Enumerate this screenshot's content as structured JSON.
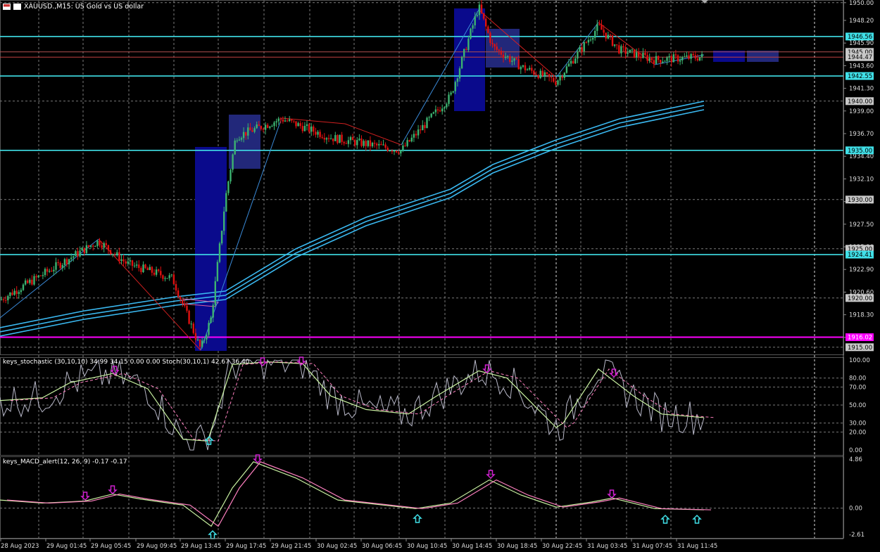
{
  "window": {
    "symbol_line": "XAUUSD.,M15:  US Gold vs US dollar"
  },
  "price_axis": {
    "ticks": [
      "1950.00",
      "1948.20",
      "1945.90",
      "1943.60",
      "1941.30",
      "1939.00",
      "1936.70",
      "1934.40",
      "1932.10",
      "1929.80",
      "1927.50",
      "1925.20",
      "1922.90",
      "1920.60",
      "1918.30",
      "1916.00"
    ],
    "level_tags": [
      {
        "text": "1946.56",
        "kind": "cyan"
      },
      {
        "text": "1945.00",
        "kind": "gray"
      },
      {
        "text": "1944.47",
        "kind": "gray"
      },
      {
        "text": "1942.55",
        "kind": "cyan"
      },
      {
        "text": "1940.00",
        "kind": "gray"
      },
      {
        "text": "1935.00",
        "kind": "cyan"
      },
      {
        "text": "1930.00",
        "kind": "gray"
      },
      {
        "text": "1925.00",
        "kind": "gray"
      },
      {
        "text": "1924.41",
        "kind": "cyan"
      },
      {
        "text": "1920.00",
        "kind": "gray"
      },
      {
        "text": "1916.02",
        "kind": "magenta"
      },
      {
        "text": "1915.00",
        "kind": "gray"
      }
    ]
  },
  "stochastic": {
    "label": "keys_stochastic (30,10,10) 34.99 34.15 0.00 0.00 Stoch(30,10,1) 42.67 36.40",
    "ticks": [
      "100.00",
      "80.00",
      "70.00",
      "50.00",
      "30.00",
      "20.00",
      "0.00"
    ]
  },
  "macd": {
    "label": "keys_MACD_alert(12, 26, 9) -0.17 -0.17",
    "ticks": [
      "4.86",
      "0.00",
      "-2.61"
    ]
  },
  "time_axis": {
    "labels": [
      "28 Aug 2023",
      "29 Aug 01:45",
      "29 Aug 05:45",
      "29 Aug 09:45",
      "29 Aug 13:45",
      "29 Aug 17:45",
      "29 Aug 21:45",
      "30 Aug 02:45",
      "30 Aug 06:45",
      "30 Aug 10:45",
      "30 Aug 14:45",
      "30 Aug 18:45",
      "30 Aug 22:45",
      "31 Aug 03:45",
      "31 Aug 07:45",
      "31 Aug 11:45"
    ]
  },
  "colors": {
    "bull_candle": "#3cb371",
    "bear_candle": "#e01010",
    "level_cyan": "#40e0e8",
    "level_magenta": "#ff00ff",
    "ma_ribbon": "#3ab8f0",
    "box_blue": "#0a0a8c",
    "box_slate": "#22287a",
    "stoch_fast": "#b8b8c8",
    "stoch_main": "#c8f0a0",
    "stoch_signal": "#ff80c0",
    "arrow_down": "#d020d0",
    "arrow_up": "#40e0e8",
    "grid": "#7a7a7a"
  },
  "chart_data": {
    "type": "candlestick",
    "symbol": "XAUUSD.",
    "timeframe": "M15",
    "price_range": [
      1914.2,
      1950.2
    ],
    "close_path_key_points": [
      {
        "time": "28 Aug 2023",
        "price": 1919.8
      },
      {
        "time": "29 Aug 05:15",
        "price": 1925.8
      },
      {
        "time": "29 Aug 13:30",
        "price": 1914.8
      },
      {
        "time": "29 Aug 17:45",
        "price": 1936.4
      },
      {
        "time": "29 Aug 21:45",
        "price": 1938.2
      },
      {
        "time": "30 Aug 08:45",
        "price": 1935.0
      },
      {
        "time": "30 Aug 15:00",
        "price": 1949.6
      },
      {
        "time": "30 Aug 23:15",
        "price": 1942.0
      },
      {
        "time": "31 Aug 04:00",
        "price": 1947.6
      },
      {
        "time": "31 Aug 11:45",
        "price": 1944.5
      }
    ],
    "horizontal_levels": [
      1946.56,
      1945.0,
      1944.47,
      1942.55,
      1935.0,
      1924.41,
      1916.02
    ],
    "stochastic_key_points": [
      52,
      85,
      5,
      98,
      95,
      40,
      88,
      25,
      88,
      36
    ],
    "macd_key_points": [
      0.8,
      1.4,
      0.3,
      -1.8,
      4.6,
      0.3,
      2.8,
      -0.05,
      1.0,
      -0.17
    ]
  }
}
